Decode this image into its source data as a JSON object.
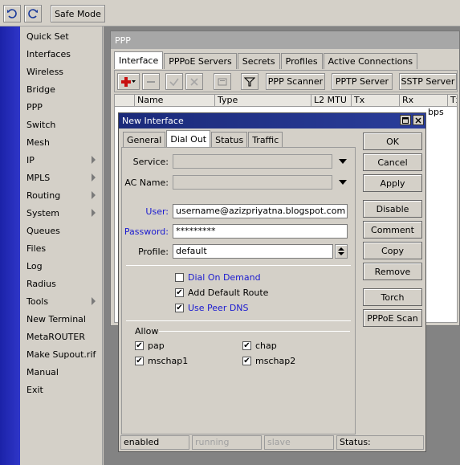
{
  "toolbar": {
    "undo_icon": "undo-icon",
    "redo_icon": "redo-icon",
    "safe_mode_label": "Safe Mode"
  },
  "sidebar": {
    "items": [
      {
        "label": "Quick Set",
        "submenu": false
      },
      {
        "label": "Interfaces",
        "submenu": false
      },
      {
        "label": "Wireless",
        "submenu": false
      },
      {
        "label": "Bridge",
        "submenu": false
      },
      {
        "label": "PPP",
        "submenu": false
      },
      {
        "label": "Switch",
        "submenu": false
      },
      {
        "label": "Mesh",
        "submenu": false
      },
      {
        "label": "IP",
        "submenu": true
      },
      {
        "label": "MPLS",
        "submenu": true
      },
      {
        "label": "Routing",
        "submenu": true
      },
      {
        "label": "System",
        "submenu": true
      },
      {
        "label": "Queues",
        "submenu": false
      },
      {
        "label": "Files",
        "submenu": false
      },
      {
        "label": "Log",
        "submenu": false
      },
      {
        "label": "Radius",
        "submenu": false
      },
      {
        "label": "Tools",
        "submenu": true
      },
      {
        "label": "New Terminal",
        "submenu": false
      },
      {
        "label": "MetaROUTER",
        "submenu": false
      },
      {
        "label": "Make Supout.rif",
        "submenu": false
      },
      {
        "label": "Manual",
        "submenu": false
      },
      {
        "label": "Exit",
        "submenu": false
      }
    ]
  },
  "ppp_window": {
    "title": "PPP",
    "tabs": [
      "Interface",
      "PPPoE Servers",
      "Secrets",
      "Profiles",
      "Active Connections"
    ],
    "toolbar_buttons": [
      "PPP Scanner",
      "PPTP Server",
      "SSTP Server"
    ],
    "columns": [
      "Name",
      "Type",
      "L2 MTU",
      "Tx",
      "Rx",
      "Tx"
    ],
    "row_partial": {
      "rx": "bps"
    }
  },
  "dialog": {
    "title": "New Interface",
    "tabs": [
      "General",
      "Dial Out",
      "Status",
      "Traffic"
    ],
    "fields": {
      "service_label": "Service:",
      "service_value": "",
      "ac_name_label": "AC Name:",
      "ac_name_value": "",
      "user_label": "User:",
      "user_value": "username@azizpriyatna.blogspot.com",
      "password_label": "Password:",
      "password_value": "*********",
      "profile_label": "Profile:",
      "profile_value": "default"
    },
    "options": {
      "dial_on_demand": {
        "label": "Dial On Demand",
        "checked": false
      },
      "add_default_route": {
        "label": "Add Default Route",
        "checked": true
      },
      "use_peer_dns": {
        "label": "Use Peer DNS",
        "checked": true
      }
    },
    "allow": {
      "heading": "Allow",
      "pap": {
        "label": "pap",
        "checked": true
      },
      "chap": {
        "label": "chap",
        "checked": true
      },
      "mschap1": {
        "label": "mschap1",
        "checked": true
      },
      "mschap2": {
        "label": "mschap2",
        "checked": true
      }
    },
    "buttons": [
      "OK",
      "Cancel",
      "Apply",
      "Disable",
      "Comment",
      "Copy",
      "Remove",
      "Torch",
      "PPPoE Scan"
    ],
    "status_bar": {
      "state": "enabled",
      "running": "running",
      "slave": "slave",
      "status": "Status:"
    }
  }
}
